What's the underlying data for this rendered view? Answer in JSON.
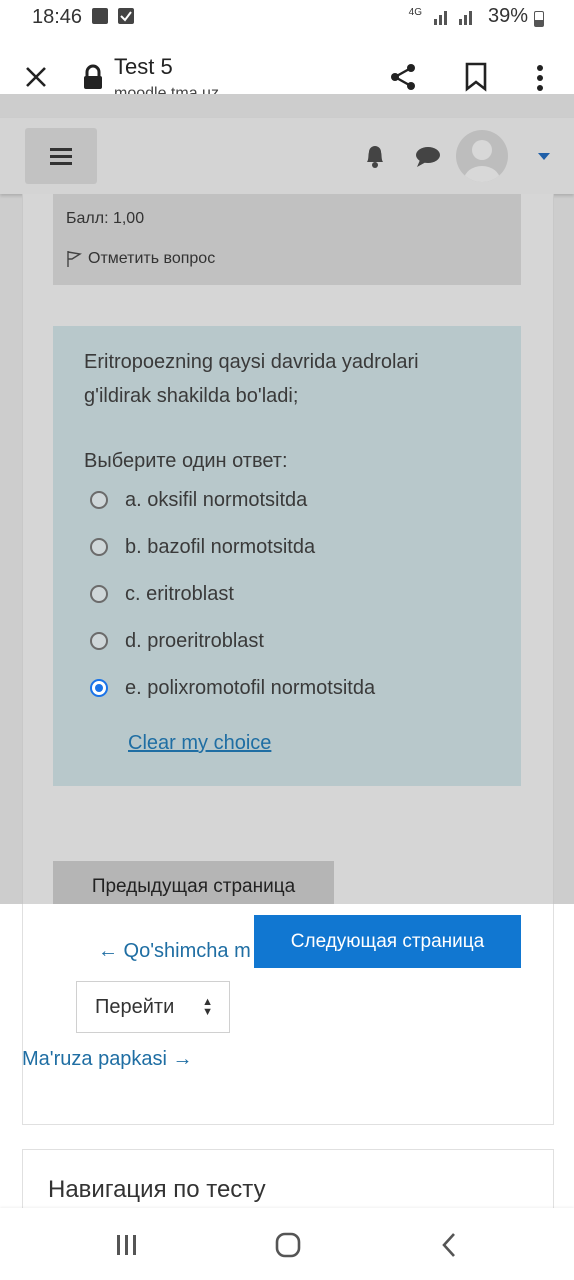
{
  "status_bar": {
    "time": "18:46",
    "network": "4G",
    "battery": "39%"
  },
  "browser": {
    "tab_title": "Test 5",
    "url": "moodle.tma.uz"
  },
  "question": {
    "score": "Балл: 1,00",
    "flag_label": "Отметить вопрос",
    "text": "Eritropoezning qaysi davrida yadrolari g'ildirak shakilda bo'ladi;",
    "prompt": "Выберите один ответ:",
    "options": [
      {
        "label": "a. oksifil normotsitda",
        "selected": false
      },
      {
        "label": "b. bazofil normotsitda",
        "selected": false
      },
      {
        "label": "c. eritroblast",
        "selected": false
      },
      {
        "label": "d. proeritroblast",
        "selected": false
      },
      {
        "label": "e. polixromotofil normotsitda",
        "selected": true
      }
    ],
    "clear_choice": "Clear my choice"
  },
  "navigation": {
    "prev_button": "Предыдущая страница",
    "next_button": "Следующая страница",
    "back_link": "← Qo'shimcha m",
    "jump_select": "Перейти",
    "forward_link": "Ma'ruza papkasi →",
    "quiz_nav_title": "Навигация по тесту"
  },
  "colors": {
    "accent": "#1177d1",
    "link": "#1f6ea3",
    "overlay": "#cdcdcd"
  },
  "icons": [
    "close-icon",
    "lock-icon",
    "share-icon",
    "bookmark-icon",
    "more-vert-icon",
    "hamburger-icon",
    "bell-icon",
    "chat-icon",
    "avatar",
    "caret-down-icon",
    "flag-icon",
    "recents-icon",
    "home-icon",
    "back-icon"
  ]
}
